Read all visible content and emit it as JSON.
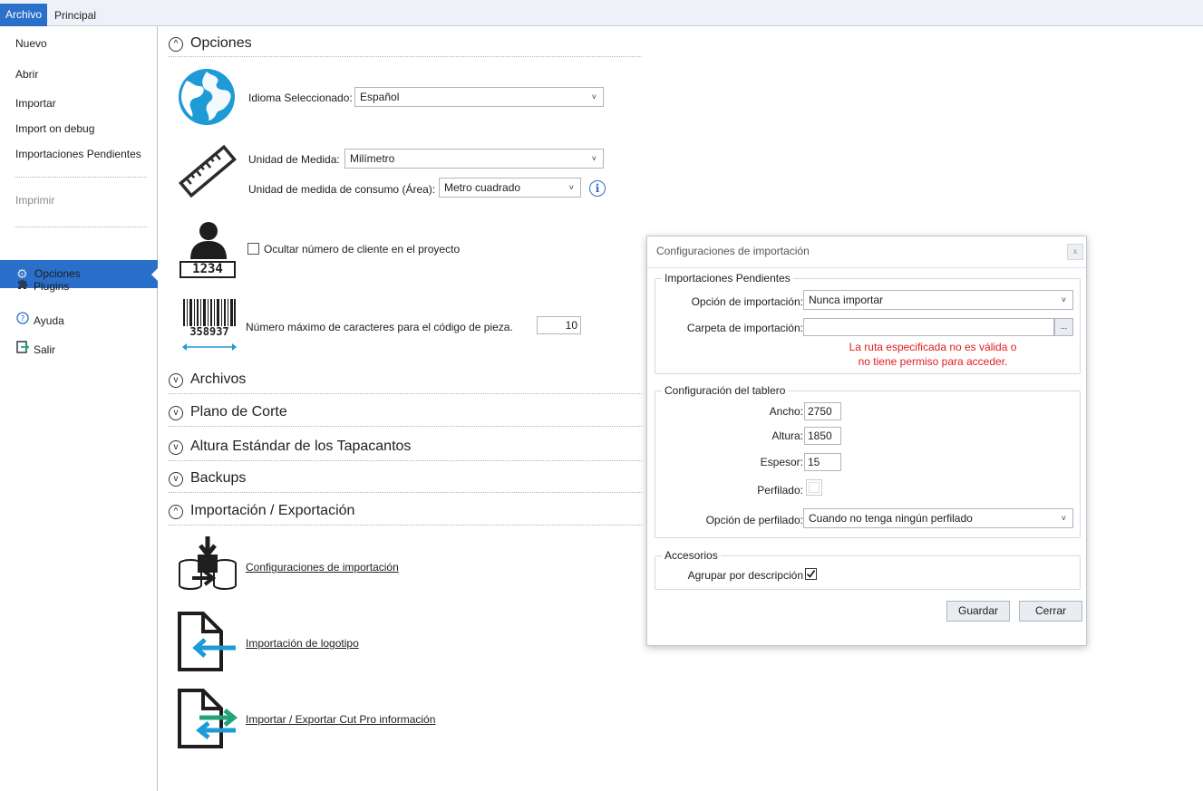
{
  "tabs": {
    "archivo": "Archivo",
    "principal": "Principal"
  },
  "sidebar": {
    "nuevo": "Nuevo",
    "abrir": "Abrir",
    "importar": "Importar",
    "import_debug": "Import on debug",
    "importaciones_pendientes": "Importaciones Pendientes",
    "imprimir": "Imprimir",
    "opciones": "Opciones",
    "plugins": "Plugins",
    "ayuda": "Ayuda",
    "salir": "Salir"
  },
  "sections": {
    "opciones": "Opciones",
    "archivos": "Archivos",
    "plano_corte": "Plano de Corte",
    "altura_tapacantos": "Altura Estándar de los Tapacantos",
    "backups": "Backups",
    "import_export": "Importación / Exportación"
  },
  "opciones": {
    "idioma_label": "Idioma Seleccionado:",
    "idioma_value": "Español",
    "unidad_label": "Unidad de Medida:",
    "unidad_value": "Milímetro",
    "consumo_label": "Unidad de medida de consumo (Área):",
    "consumo_value": "Metro cuadrado",
    "ocultar_label": "Ocultar número de cliente en el proyecto",
    "cliente_icon_number": "1234",
    "max_caracteres_label": "Número máximo de caracteres para el código de pieza.",
    "max_caracteres_value": "10",
    "barcode_number": "358937"
  },
  "import_export": {
    "config_import": "Configuraciones de importación",
    "import_logo": "Importación de logotipo",
    "import_export_cutpro": "Importar / Exportar Cut Pro información"
  },
  "dialog": {
    "title": "Configuraciones de importación",
    "close_glyph": "x",
    "group_pendientes": "Importaciones Pendientes",
    "opcion_import_label": "Opción de importación:",
    "opcion_import_value": "Nunca importar",
    "carpeta_label": "Carpeta de importación:",
    "carpeta_value": "",
    "browse_label": "...",
    "error_line1": "La ruta especificada no es válida o",
    "error_line2": "no tiene permiso para acceder.",
    "group_tablero": "Configuración del tablero",
    "ancho_label": "Ancho:",
    "ancho_value": "2750",
    "altura_label": "Altura:",
    "altura_value": "1850",
    "espesor_label": "Espesor:",
    "espesor_value": "15",
    "perfilado_label": "Perfilado:",
    "opcion_perfilado_label": "Opción de perfilado:",
    "opcion_perfilado_value": "Cuando no tenga ningún perfilado",
    "group_accesorios": "Accesorios",
    "agrupar_label": "Agrupar por descripción",
    "guardar": "Guardar",
    "cerrar": "Cerrar"
  },
  "colors": {
    "accent": "#2a6fc9",
    "error": "#e01d1d",
    "icon_blue": "#1e9ad6",
    "icon_green": "#22a37a"
  }
}
